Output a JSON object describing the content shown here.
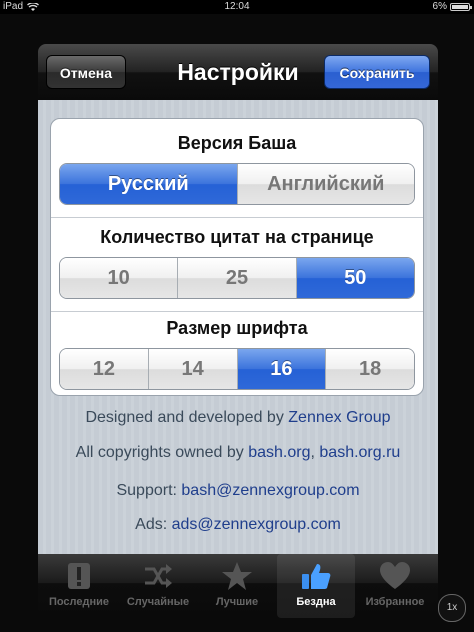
{
  "status_bar": {
    "device": "iPad",
    "time": "12:04",
    "battery": "6%"
  },
  "nav": {
    "title": "Настройки",
    "cancel_label": "Отмена",
    "save_label": "Сохранить"
  },
  "settings": {
    "version": {
      "title": "Версия Баша",
      "options": [
        "Русский",
        "Английский"
      ],
      "selected": "Русский"
    },
    "quotes_per_page": {
      "title": "Количество цитат на странице",
      "options": [
        "10",
        "25",
        "50"
      ],
      "selected": "50"
    },
    "font_size": {
      "title": "Размер шрифта",
      "options": [
        "12",
        "14",
        "16",
        "18"
      ],
      "selected": "16"
    }
  },
  "credits": {
    "designed_prefix": "Designed and developed by",
    "designed_link": "Zennex Group",
    "copyright_prefix": "All copyrights owned by",
    "copyright_link1": "bash.org",
    "copyright_sep": ",",
    "copyright_link2": "bash.org.ru",
    "support_prefix": "Support:",
    "support_link": "bash@zennexgroup.com",
    "ads_prefix": "Ads:",
    "ads_link": "ads@zennexgroup.com"
  },
  "tabs": [
    {
      "label": "Последние",
      "icon": "exclamation-icon"
    },
    {
      "label": "Случайные",
      "icon": "shuffle-icon"
    },
    {
      "label": "Лучшие",
      "icon": "star-icon"
    },
    {
      "label": "Бездна",
      "icon": "thumbs-up-icon",
      "selected": true
    },
    {
      "label": "Избранное",
      "icon": "heart-icon"
    }
  ],
  "zoom_label": "1x",
  "colors": {
    "accent_blue": "#2f69d8",
    "link": "#1f3e8c"
  }
}
